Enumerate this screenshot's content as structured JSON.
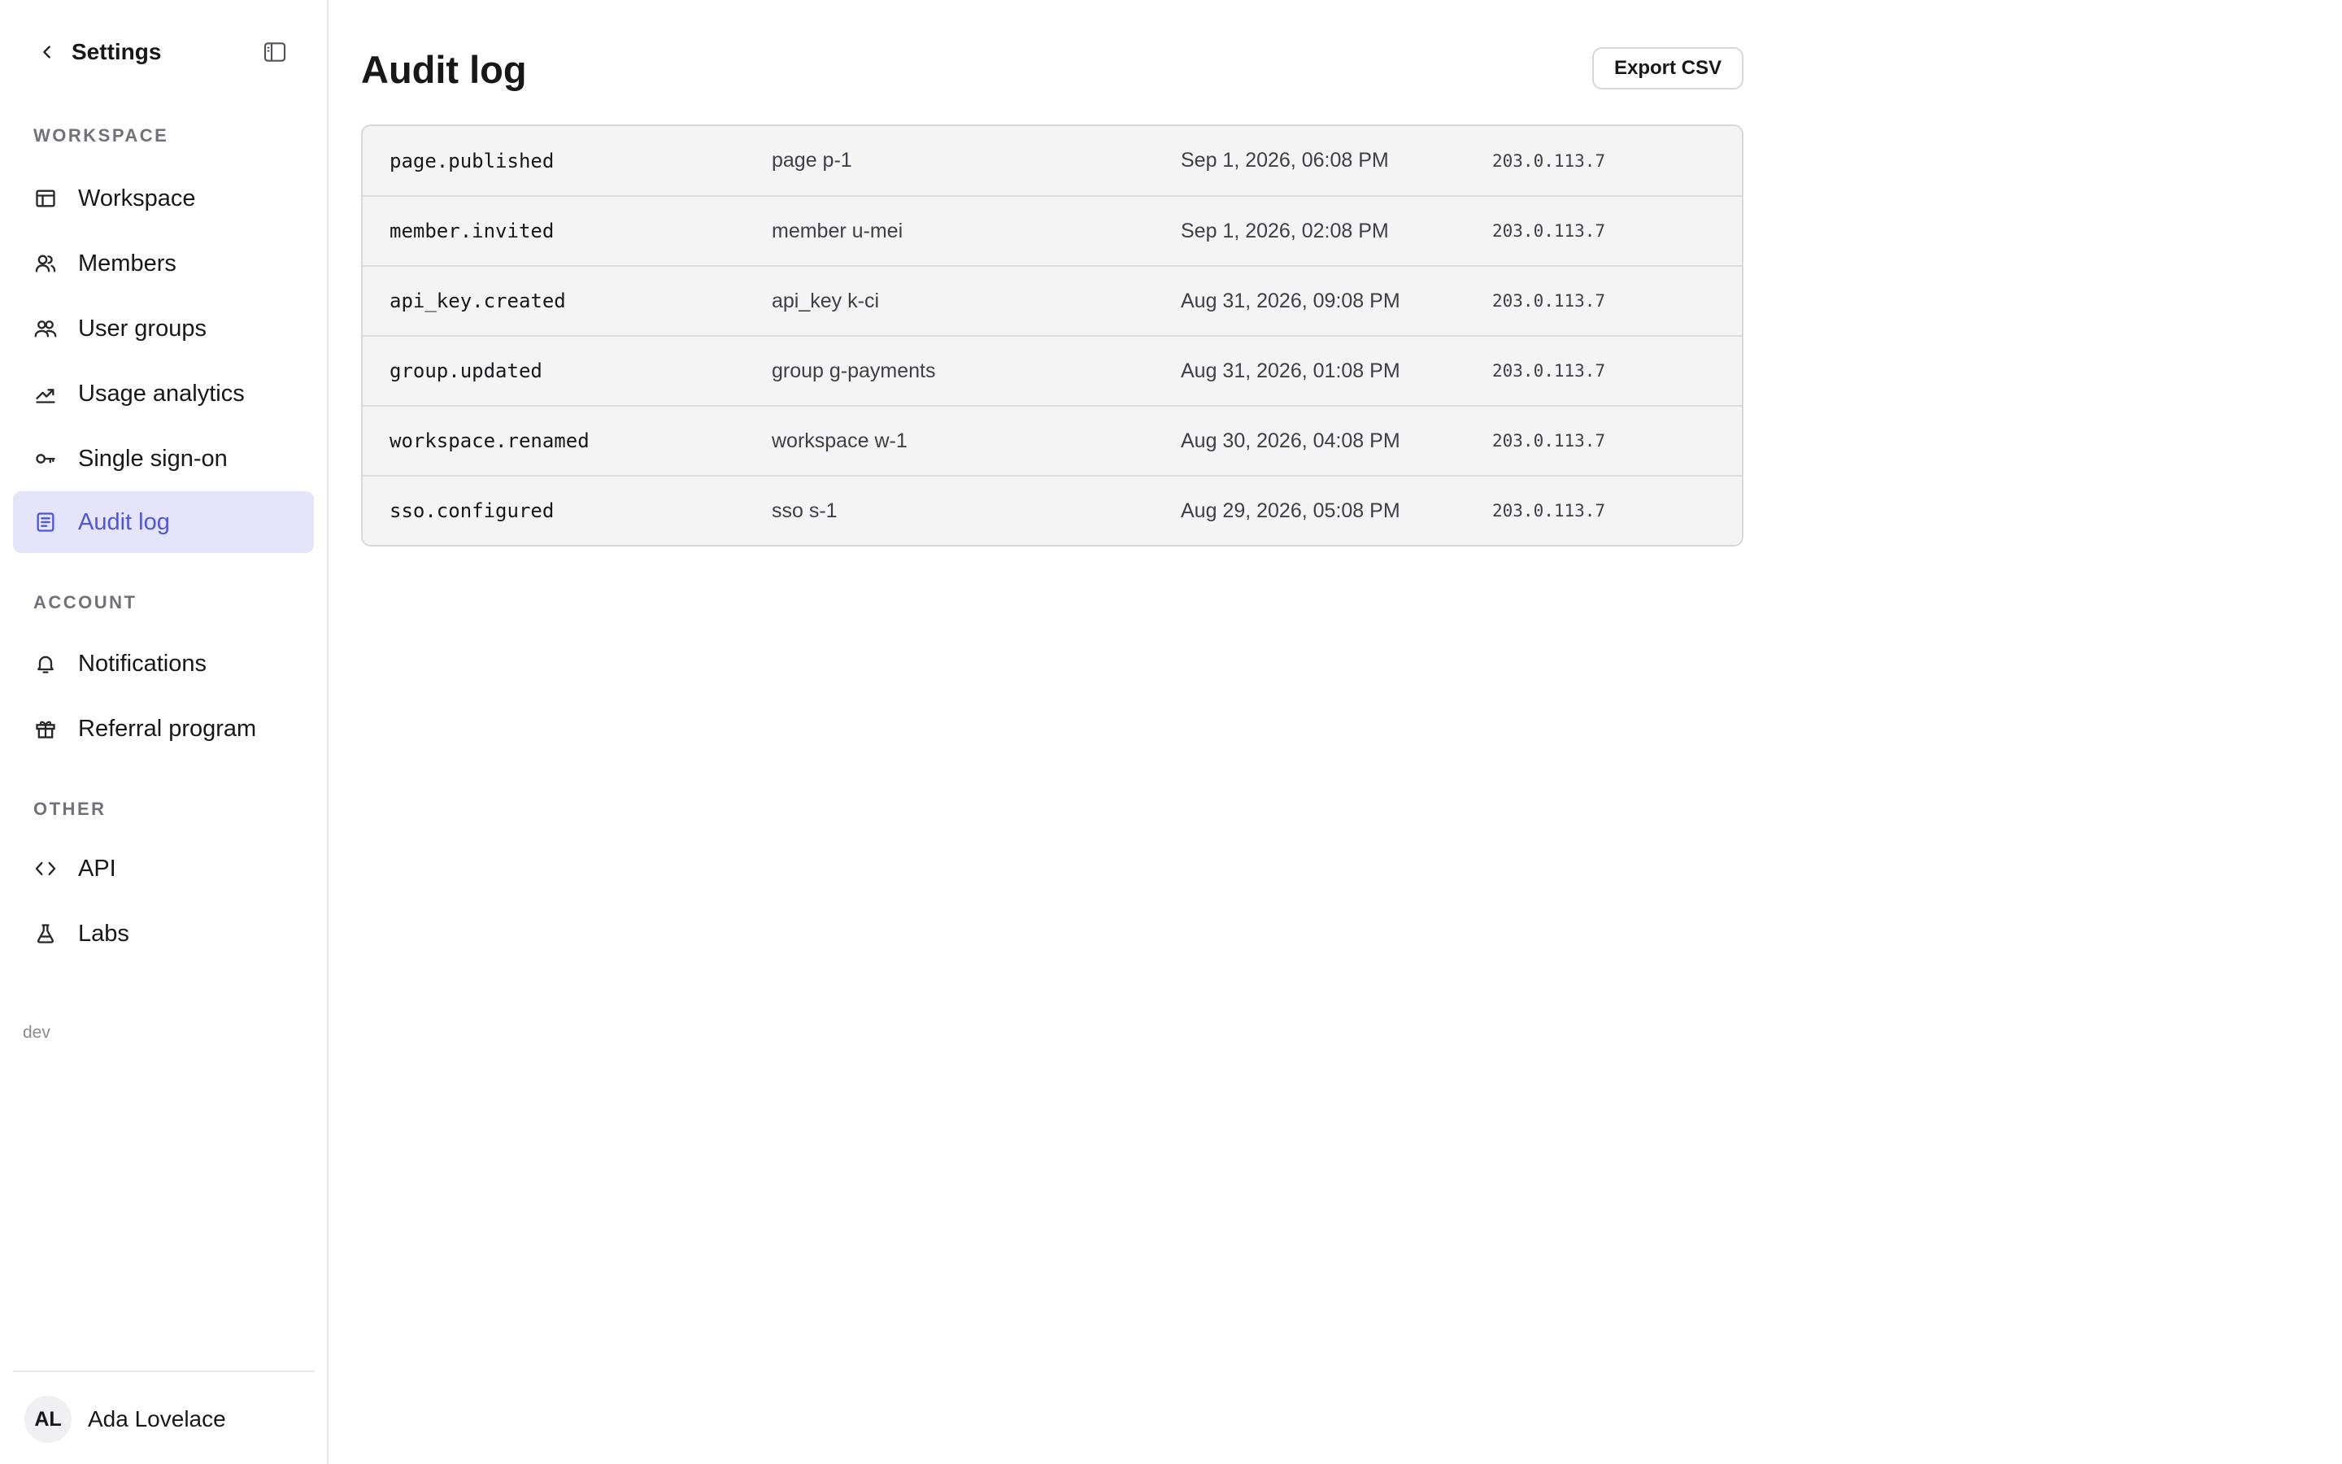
{
  "sidebar": {
    "title": "Settings",
    "sections": [
      {
        "label": "WORKSPACE",
        "items": [
          {
            "label": "Workspace",
            "icon": "layout-icon"
          },
          {
            "label": "Members",
            "icon": "user-icon"
          },
          {
            "label": "User groups",
            "icon": "users-icon"
          },
          {
            "label": "Usage analytics",
            "icon": "trend-icon"
          },
          {
            "label": "Single sign-on",
            "icon": "key-icon"
          },
          {
            "label": "Audit log",
            "icon": "document-icon",
            "active": true
          }
        ]
      },
      {
        "label": "ACCOUNT",
        "items": [
          {
            "label": "Notifications",
            "icon": "bell-icon"
          },
          {
            "label": "Referral program",
            "icon": "gift-icon"
          }
        ]
      },
      {
        "label": "OTHER",
        "items": [
          {
            "label": "API",
            "icon": "code-icon"
          },
          {
            "label": "Labs",
            "icon": "flask-icon"
          }
        ]
      }
    ],
    "env_label": "dev",
    "user": {
      "initials": "AL",
      "name": "Ada Lovelace"
    }
  },
  "main": {
    "title": "Audit log",
    "export_label": "Export CSV",
    "rows": [
      {
        "action": "page.published",
        "target": "page p-1",
        "time": "Sep 1, 2026, 06:08 PM",
        "ip": "203.0.113.7"
      },
      {
        "action": "member.invited",
        "target": "member u-mei",
        "time": "Sep 1, 2026, 02:08 PM",
        "ip": "203.0.113.7"
      },
      {
        "action": "api_key.created",
        "target": "api_key k-ci",
        "time": "Aug 31, 2026, 09:08 PM",
        "ip": "203.0.113.7"
      },
      {
        "action": "group.updated",
        "target": "group g-payments",
        "time": "Aug 31, 2026, 01:08 PM",
        "ip": "203.0.113.7"
      },
      {
        "action": "workspace.renamed",
        "target": "workspace w-1",
        "time": "Aug 30, 2026, 04:08 PM",
        "ip": "203.0.113.7"
      },
      {
        "action": "sso.configured",
        "target": "sso s-1",
        "time": "Aug 29, 2026, 05:08 PM",
        "ip": "203.0.113.7"
      }
    ]
  },
  "colors": {
    "accent": "#4f56d9",
    "active_bg": "#e4e4fb",
    "border": "#e5e5e5",
    "row_bg": "#f4f4f5"
  }
}
